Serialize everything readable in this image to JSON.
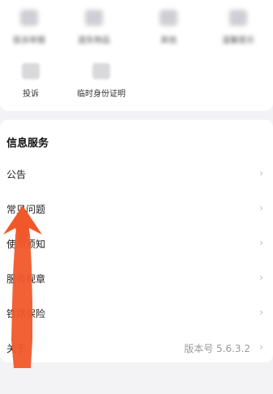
{
  "grid": {
    "items": [
      {
        "label": "投诉举报",
        "icon": "document-icon"
      },
      {
        "label": "遗失物品",
        "icon": "bag-icon"
      },
      {
        "label": "其他",
        "icon": "box-icon"
      },
      {
        "label": "温馨提示",
        "icon": "bell-icon"
      },
      {
        "label": "投诉",
        "icon": "complaint-icon"
      },
      {
        "label": "临时身份证明",
        "icon": "id-card-icon"
      }
    ]
  },
  "info": {
    "title": "信息服务",
    "items": [
      {
        "label": "公告"
      },
      {
        "label": "常见问题"
      },
      {
        "label": "使用须知"
      },
      {
        "label": "服务规章"
      },
      {
        "label": "铁路保险"
      },
      {
        "label": "关于",
        "value": "版本号 5.6.3.2"
      }
    ],
    "chevron": "›"
  },
  "colors": {
    "arrow": "#f0582a",
    "card": "#ffffff",
    "background": "#f3f3f5"
  }
}
